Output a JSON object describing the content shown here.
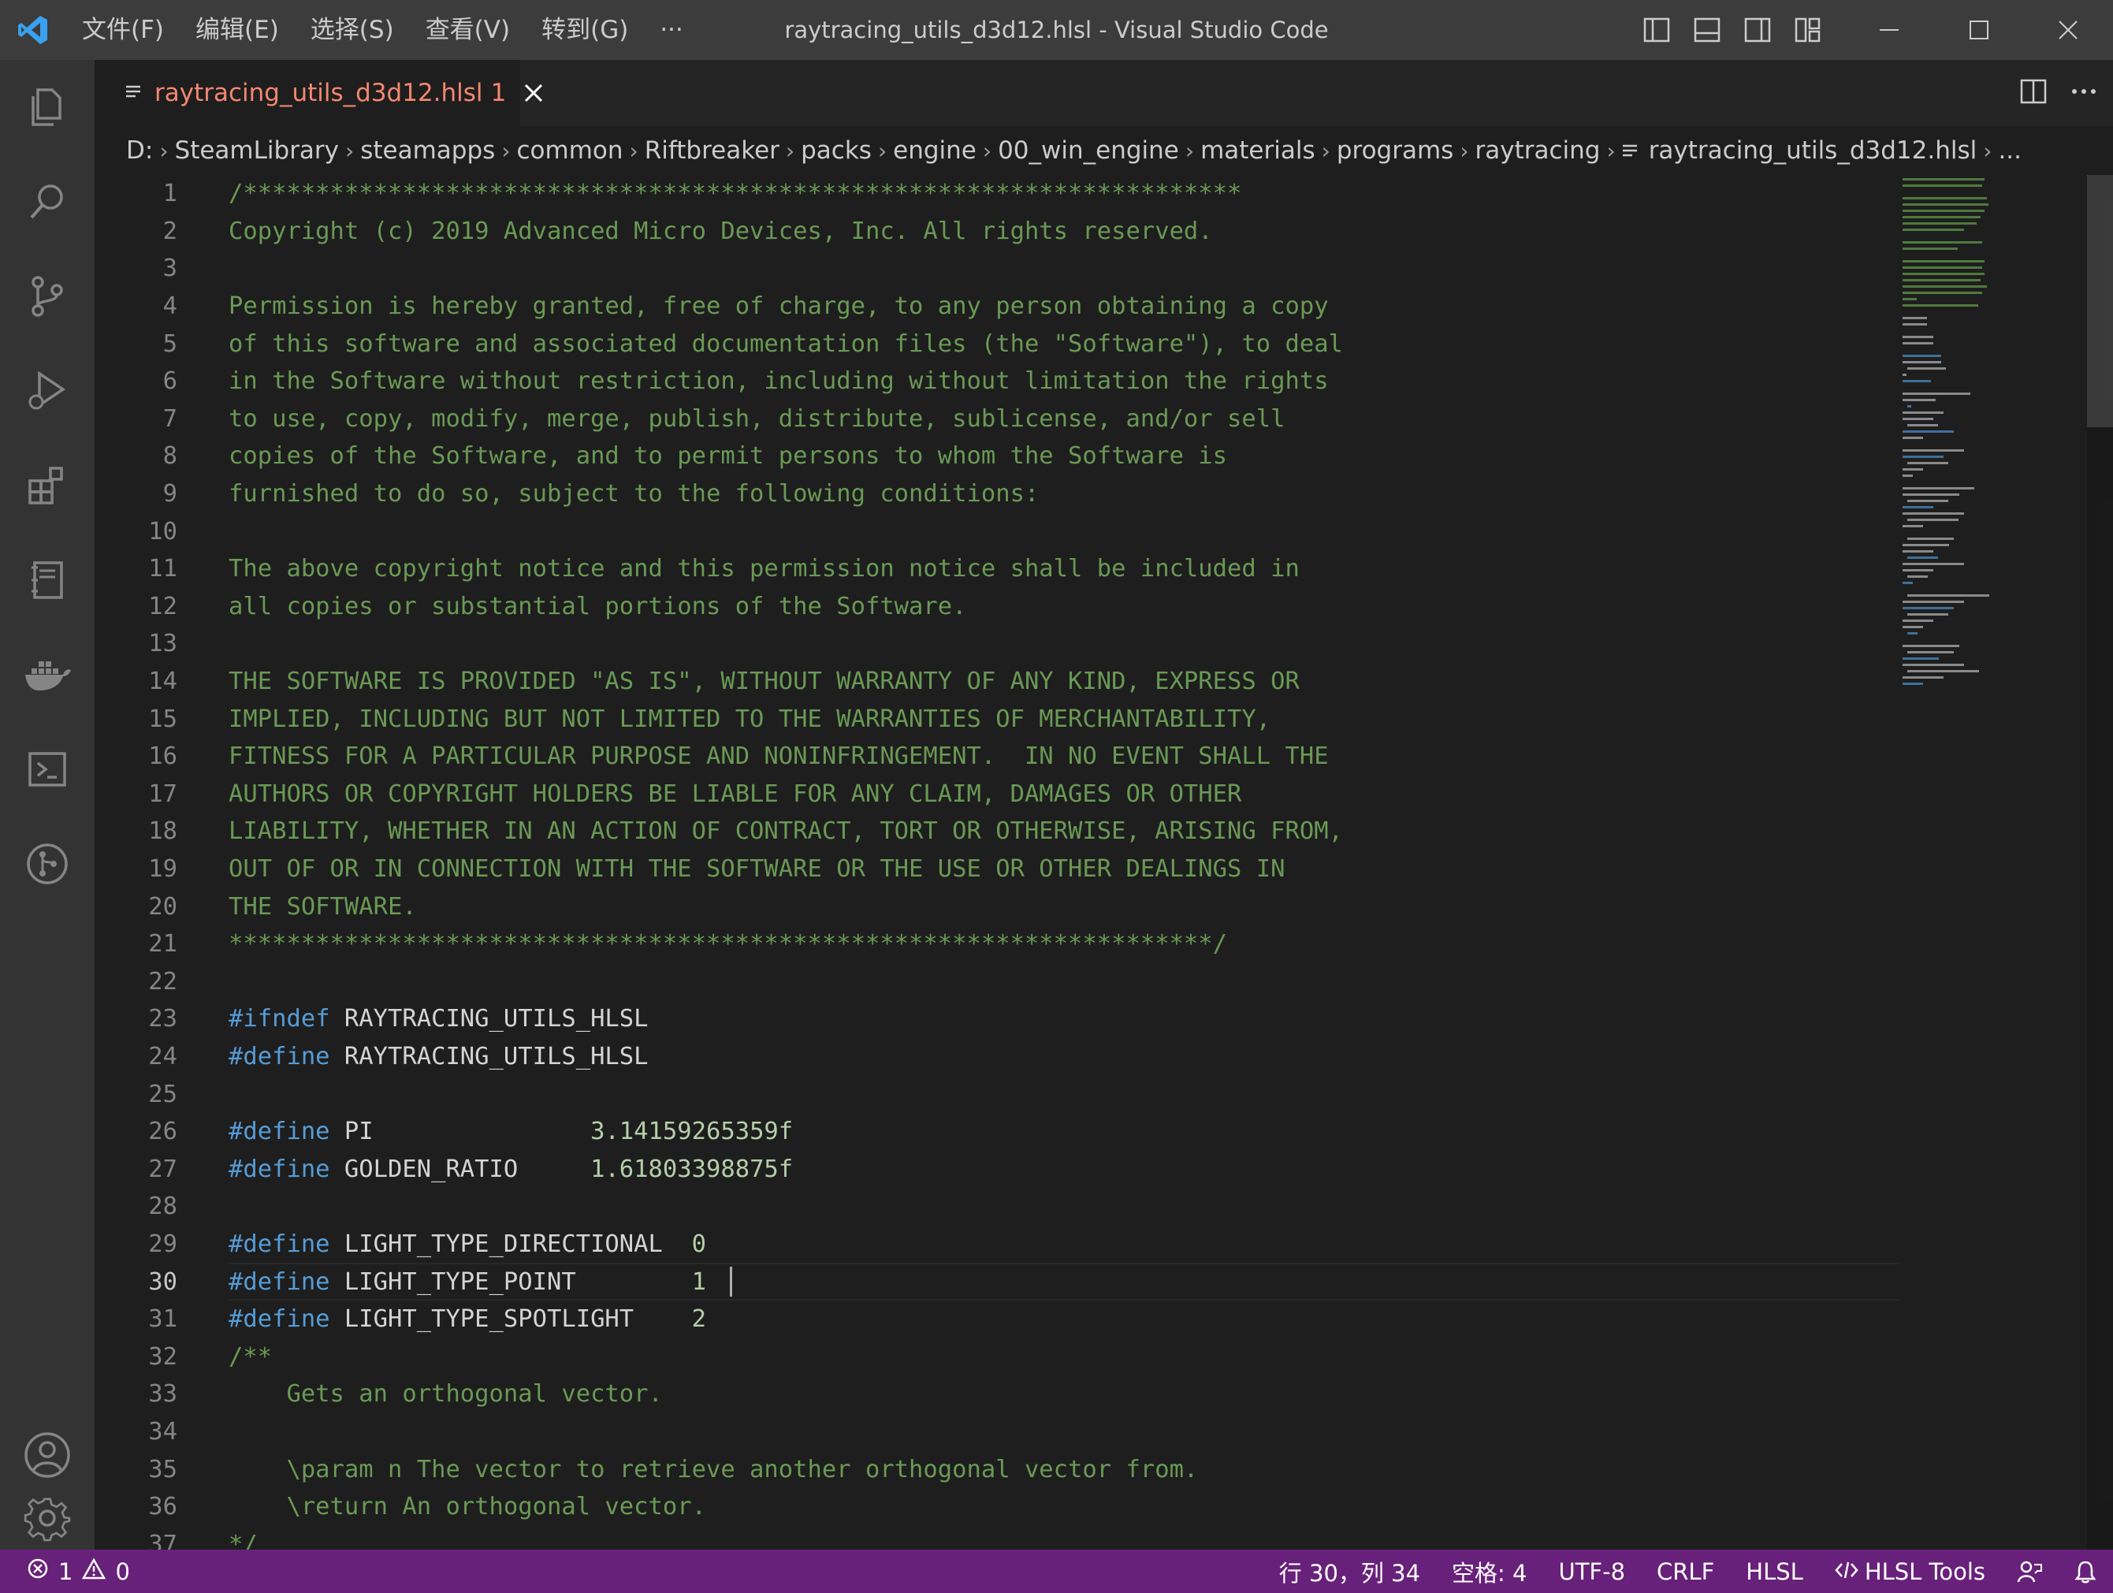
{
  "window": {
    "title": "raytracing_utils_d3d12.hlsl - Visual Studio Code",
    "menu": [
      "文件(F)",
      "编辑(E)",
      "选择(S)",
      "查看(V)",
      "转到(G)",
      "···"
    ]
  },
  "colors": {
    "titlebar": "#3c3c3c",
    "activitybar": "#333333",
    "statusbar": "#68217a",
    "comment": "#6a9955",
    "keyword": "#569cd6",
    "number": "#b5cea8",
    "tab_error": "#f48771"
  },
  "activity_icons": [
    "explorer-icon",
    "search-icon",
    "source-control-icon",
    "run-debug-icon",
    "extensions-icon",
    "notebook-icon",
    "docker-icon",
    "terminal-icon",
    "git-graph-icon",
    "account-icon",
    "settings-gear-icon"
  ],
  "tab": {
    "label": "raytracing_utils_d3d12.hlsl",
    "problems": "1"
  },
  "breadcrumb": [
    "D:",
    "SteamLibrary",
    "steamapps",
    "common",
    "Riftbreaker",
    "packs",
    "engine",
    "00_win_engine",
    "materials",
    "programs",
    "raytracing",
    "raytracing_utils_d3d12.hlsl",
    "..."
  ],
  "editor": {
    "current_line": 30,
    "lines": [
      {
        "n": "1",
        "text": "/*********************************************************************"
      },
      {
        "n": "2",
        "text": "Copyright (c) 2019 Advanced Micro Devices, Inc. All rights reserved."
      },
      {
        "n": "3",
        "text": ""
      },
      {
        "n": "4",
        "text": "Permission is hereby granted, free of charge, to any person obtaining a copy"
      },
      {
        "n": "5",
        "text": "of this software and associated documentation files (the \"Software\"), to deal"
      },
      {
        "n": "6",
        "text": "in the Software without restriction, including without limitation the rights"
      },
      {
        "n": "7",
        "text": "to use, copy, modify, merge, publish, distribute, sublicense, and/or sell"
      },
      {
        "n": "8",
        "text": "copies of the Software, and to permit persons to whom the Software is"
      },
      {
        "n": "9",
        "text": "furnished to do so, subject to the following conditions:"
      },
      {
        "n": "10",
        "text": ""
      },
      {
        "n": "11",
        "text": "The above copyright notice and this permission notice shall be included in"
      },
      {
        "n": "12",
        "text": "all copies or substantial portions of the Software."
      },
      {
        "n": "13",
        "text": ""
      },
      {
        "n": "14",
        "text": "THE SOFTWARE IS PROVIDED \"AS IS\", WITHOUT WARRANTY OF ANY KIND, EXPRESS OR"
      },
      {
        "n": "15",
        "text": "IMPLIED, INCLUDING BUT NOT LIMITED TO THE WARRANTIES OF MERCHANTABILITY,"
      },
      {
        "n": "16",
        "text": "FITNESS FOR A PARTICULAR PURPOSE AND NONINFRINGEMENT.  IN NO EVENT SHALL THE"
      },
      {
        "n": "17",
        "text": "AUTHORS OR COPYRIGHT HOLDERS BE LIABLE FOR ANY CLAIM, DAMAGES OR OTHER"
      },
      {
        "n": "18",
        "text": "LIABILITY, WHETHER IN AN ACTION OF CONTRACT, TORT OR OTHERWISE, ARISING FROM,"
      },
      {
        "n": "19",
        "text": "OUT OF OR IN CONNECTION WITH THE SOFTWARE OR THE USE OR OTHER DEALINGS IN"
      },
      {
        "n": "20",
        "text": "THE SOFTWARE."
      },
      {
        "n": "21",
        "text": "********************************************************************/"
      },
      {
        "n": "22",
        "text": ""
      },
      {
        "n": "23",
        "kw": "#ifndef",
        "rest": " RAYTRACING_UTILS_HLSL"
      },
      {
        "n": "24",
        "kw": "#define",
        "rest": " RAYTRACING_UTILS_HLSL"
      },
      {
        "n": "25",
        "text": ""
      },
      {
        "n": "26",
        "kw": "#define",
        "rest": " PI               ",
        "num": "3.14159265359f"
      },
      {
        "n": "27",
        "kw": "#define",
        "rest": " GOLDEN_RATIO     ",
        "num": "1.61803398875f"
      },
      {
        "n": "28",
        "text": ""
      },
      {
        "n": "29",
        "kw": "#define",
        "rest": " LIGHT_TYPE_DIRECTIONAL  ",
        "num": "0"
      },
      {
        "n": "30",
        "kw": "#define",
        "rest": " LIGHT_TYPE_POINT        ",
        "num": "1"
      },
      {
        "n": "31",
        "kw": "#define",
        "rest": " LIGHT_TYPE_SPOTLIGHT    ",
        "num": "2"
      },
      {
        "n": "32",
        "text": "/**"
      },
      {
        "n": "33",
        "text": "    Gets an orthogonal vector."
      },
      {
        "n": "34",
        "text": ""
      },
      {
        "n": "35",
        "text": "    \\param n The vector to retrieve another orthogonal vector from."
      },
      {
        "n": "36",
        "text": "    \\return An orthogonal vector."
      },
      {
        "n": "37",
        "text": "*/"
      }
    ]
  },
  "status": {
    "errors": "1",
    "warnings": "0",
    "position": "行 30，列 34",
    "spaces": "空格: 4",
    "encoding": "UTF-8",
    "eol": "CRLF",
    "language": "HLSL",
    "extension": "HLSL Tools"
  }
}
